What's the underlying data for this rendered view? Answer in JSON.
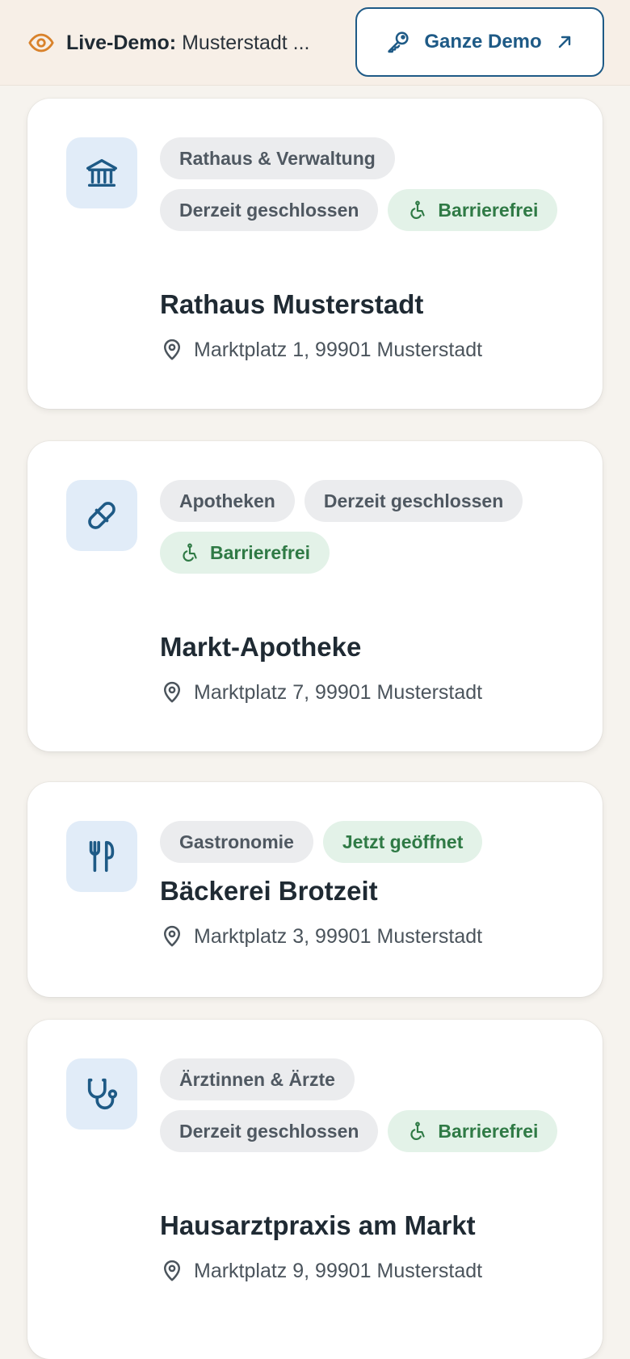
{
  "header": {
    "live_label": "Live-Demo:",
    "live_value": "Musterstadt ...",
    "demo_button_label": "Ganze Demo"
  },
  "cards": [
    {
      "icon": "building-columns-icon",
      "tags": [
        "Rathaus & Verwaltung",
        "Derzeit geschlossen",
        "Barrierefrei"
      ],
      "title": "Rathaus Musterstadt",
      "address": "Marktplatz 1, 99901 Musterstadt"
    },
    {
      "icon": "pill-icon",
      "tags": [
        "Apotheken",
        "Derzeit geschlossen",
        "Barrierefrei"
      ],
      "title": "Markt-Apotheke",
      "address": "Marktplatz 7, 99901 Musterstadt"
    },
    {
      "icon": "utensils-icon",
      "tags": [
        "Gastronomie",
        "Jetzt geöffnet"
      ],
      "title": "Bäckerei Brotzeit",
      "address": "Marktplatz 3, 99901 Musterstadt"
    },
    {
      "icon": "stethoscope-icon",
      "tags": [
        "Ärztinnen & Ärzte",
        "Derzeit geschlossen",
        "Barrierefrei"
      ],
      "title": "Hausarztpraxis am Markt",
      "address": "Marktplatz 9, 99901 Musterstadt"
    }
  ],
  "colors": {
    "primary": "#1e5a86",
    "accent_orange": "#d9822b",
    "open_green": "#2f7a45",
    "background": "#f6f3ee"
  }
}
